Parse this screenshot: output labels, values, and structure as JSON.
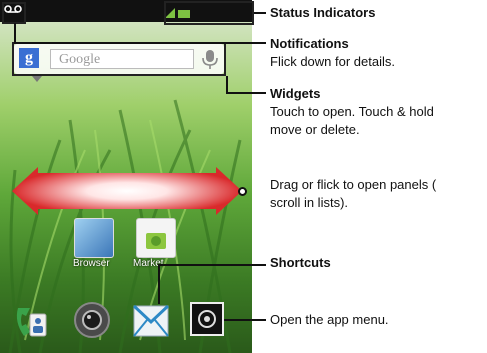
{
  "search": {
    "placeholder": "Google"
  },
  "apps": [
    {
      "label": "Browser"
    },
    {
      "label": "Market"
    }
  ],
  "annotations": {
    "status_indicators": "Status Indicators",
    "notifications_title": "Notifications",
    "notifications_desc": "Flick down for details.",
    "widgets_title": "Widgets",
    "widgets_desc_1": "Touch to open. Touch & hold",
    "widgets_desc_2": "move or delete.",
    "panels_desc_1": "Drag or flick to open panels (",
    "panels_desc_2": "scroll in lists).",
    "shortcuts_title": "Shortcuts",
    "app_menu_desc": "Open the app menu."
  },
  "colors": {
    "status_green": "#7dc142",
    "arrow_red": "#d9292b",
    "google_blue": "#3a6fd3"
  },
  "icons": [
    "voicemail-icon",
    "signal-icon",
    "battery-icon",
    "google-logo-icon",
    "microphone-icon",
    "phone-icon",
    "camera-icon",
    "email-icon",
    "app-menu-icon"
  ]
}
